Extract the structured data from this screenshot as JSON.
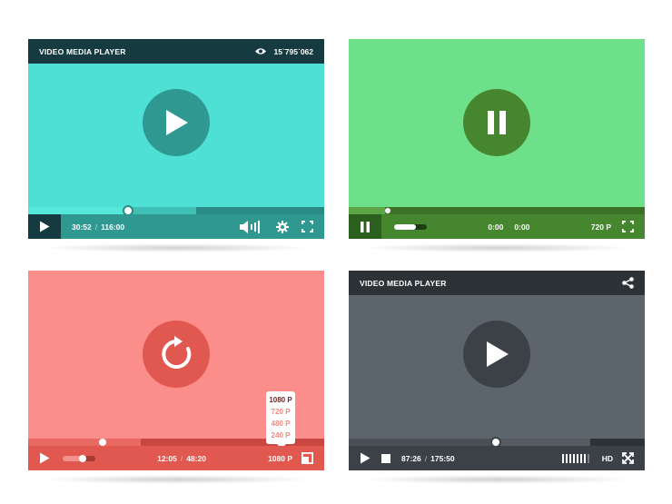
{
  "player1": {
    "title": "VIDEO MEDIA PLAYER",
    "views": "15`795`062",
    "current_time": "30:52",
    "total_time": "116:00",
    "progress": 0.34,
    "colors": {
      "screen": "#4ee0d4",
      "bar": "#153a40",
      "controls": "#2e9891"
    }
  },
  "player2": {
    "current_time": "0:00",
    "total_time": "0:00",
    "quality": "720 P",
    "progress": 0.1,
    "colors": {
      "screen": "#6ee08a",
      "controls": "#46862f"
    }
  },
  "player3": {
    "current_time": "12:05",
    "total_time": "48:20",
    "quality": "1080 P",
    "quality_options": [
      "1080 P",
      "720 P",
      "480 P",
      "240 P"
    ],
    "progress": 0.25,
    "colors": {
      "screen": "#fb8e8a",
      "controls": "#e0584f"
    }
  },
  "player4": {
    "title": "VIDEO MEDIA PLAYER",
    "current_time": "87:26",
    "total_time": "175:50",
    "quality": "HD",
    "progress": 0.5,
    "colors": {
      "screen": "#5c646c",
      "bar": "#2d3236",
      "controls": "#3b4146"
    }
  }
}
